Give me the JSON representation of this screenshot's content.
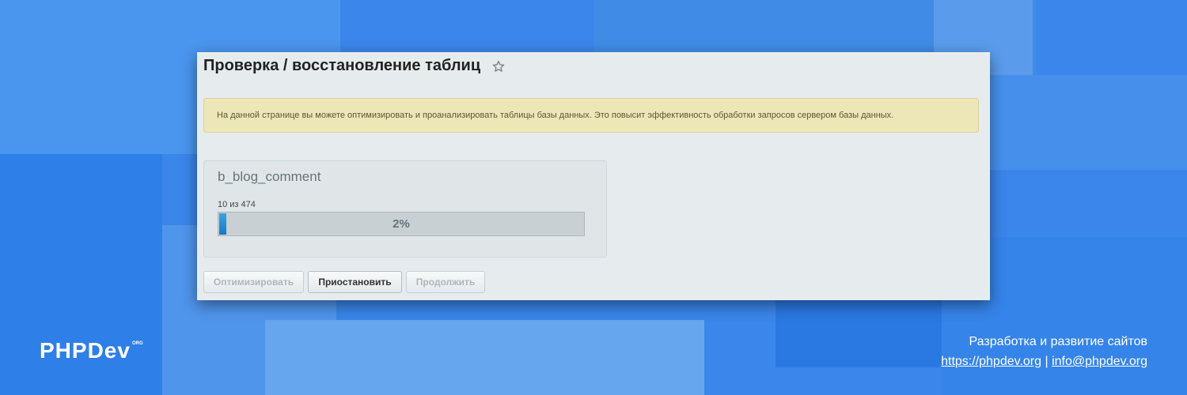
{
  "page": {
    "title": "Проверка / восстановление таблиц",
    "favorite_icon": "star-icon"
  },
  "notice": {
    "text": "На данной странице вы можете оптимизировать и проанализировать таблицы базы данных. Это повысит эффективность обработки запросов сервером базы данных."
  },
  "progress": {
    "table_name": "b_blog_comment",
    "count_text": "10 из 474",
    "percent_label": "2%",
    "fraction": 0.02,
    "fill_color": "#1d86cc"
  },
  "buttons": {
    "optimize": "Оптимизировать",
    "pause": "Приостановить",
    "resume": "Продолжить"
  },
  "branding": {
    "logo_text": "PHPDev",
    "logo_suffix": "ORG",
    "tagline": "Разработка и развитие сайтов",
    "site_link": "https://phpdev.org",
    "separator": "|",
    "email": "info@phpdev.org"
  }
}
